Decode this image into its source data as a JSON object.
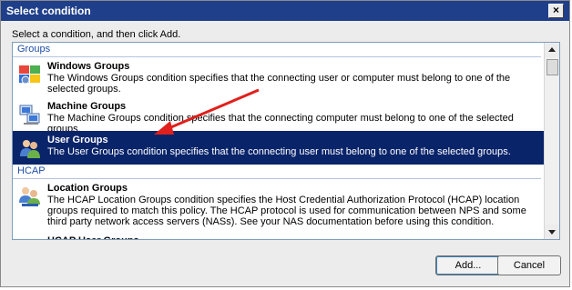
{
  "window": {
    "title": "Select condition",
    "close_glyph": "×"
  },
  "instruction": "Select a condition, and then click Add.",
  "groups": [
    {
      "header": "Groups",
      "items": [
        {
          "name": "Windows Groups",
          "icon": "windows-groups-icon",
          "description": "The Windows Groups condition specifies that the connecting user or computer must belong to one of the selected groups."
        },
        {
          "name": "Machine Groups",
          "icon": "machine-groups-icon",
          "description": "The Machine Groups condition specifies that the connecting computer must belong to one of the selected groups."
        },
        {
          "name": "User Groups",
          "icon": "user-groups-icon",
          "selected": true,
          "description": "The User Groups condition specifies that the connecting user must belong to one of the selected groups."
        }
      ]
    },
    {
      "header": "HCAP",
      "items": [
        {
          "name": "Location Groups",
          "icon": "location-groups-icon",
          "description": "The HCAP Location Groups condition specifies the Host Credential Authorization Protocol (HCAP) location groups required to match this policy. The HCAP protocol is used for communication between NPS and some third party network access servers (NASs). See your NAS documentation before using this condition."
        },
        {
          "name": "HCAP User Groups",
          "icon": "hcap-user-groups-icon",
          "description": ""
        }
      ]
    }
  ],
  "buttons": {
    "add": "Add...",
    "cancel": "Cancel"
  },
  "colors": {
    "selection": "#0a246a",
    "titlebar": "#1f3f8a",
    "annotation_arrow": "#e0201c",
    "group_header": "#1f4ea8"
  }
}
